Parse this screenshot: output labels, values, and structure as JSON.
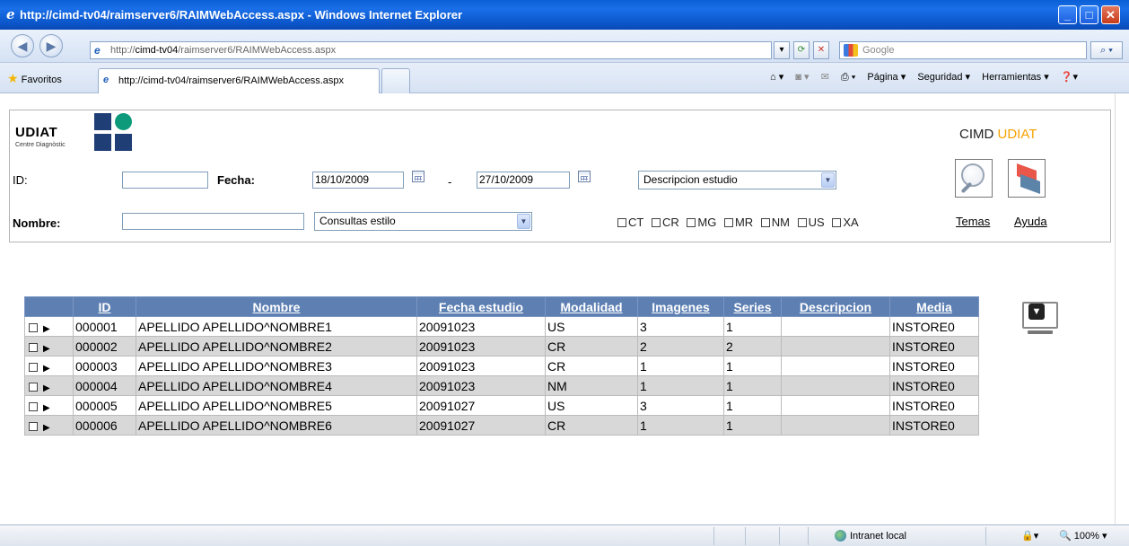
{
  "window": {
    "title": "http://cimd-tv04/raimserver6/RAIMWebAccess.aspx - Windows Internet Explorer",
    "min_label": "_",
    "max_label": "□",
    "close_label": "✕"
  },
  "addressbar": {
    "url_prefix": "http://",
    "url_host": "cimd-tv04",
    "url_path": "/raimserver6/RAIMWebAccess.aspx",
    "search_placeholder": "Google"
  },
  "favbar": {
    "favorites_label": "Favoritos",
    "tab_title": "http://cimd-tv04/raimserver6/RAIMWebAccess.aspx",
    "cmd_pagina": "Página ▾",
    "cmd_seguridad": "Seguridad ▾",
    "cmd_herramientas": "Herramientas ▾"
  },
  "logo": {
    "name": "UDIAT",
    "subtitle": "Centre Diagnòstic",
    "colors": {
      "navy": "#1f3e76",
      "teal": "#0c9a7b"
    }
  },
  "brand": {
    "prefix": "CIMD ",
    "accent": "UDIAT",
    "accent_color": "#f5a300"
  },
  "form": {
    "id_label": "ID:",
    "id_value": "",
    "fecha_label": "Fecha:",
    "date_from": "18/10/2009",
    "date_sep": "-",
    "date_to": "27/10/2009",
    "descripcion_select": "Descripcion estudio",
    "nombre_label": "Nombre:",
    "nombre_value": "",
    "consultas_select": "Consultas estilo",
    "modalities": [
      "CT",
      "CR",
      "MG",
      "MR",
      "NM",
      "US",
      "XA"
    ],
    "temas_link": "Temas",
    "ayuda_link": "Ayuda"
  },
  "table": {
    "headers": [
      "ID",
      "Nombre",
      "Fecha estudio",
      "Modalidad",
      "Imagenes",
      "Series",
      "Descripcion",
      "Media"
    ],
    "rows": [
      [
        "000001",
        "APELLIDO APELLIDO^NOMBRE1",
        "20091023",
        "US",
        "3",
        "1",
        "",
        "INSTORE0"
      ],
      [
        "000002",
        "APELLIDO APELLIDO^NOMBRE2",
        "20091023",
        "CR",
        "2",
        "2",
        "",
        "INSTORE0"
      ],
      [
        "000003",
        "APELLIDO APELLIDO^NOMBRE3",
        "20091023",
        "CR",
        "1",
        "1",
        "",
        "INSTORE0"
      ],
      [
        "000004",
        "APELLIDO APELLIDO^NOMBRE4",
        "20091023",
        "NM",
        "1",
        "1",
        "",
        "INSTORE0"
      ],
      [
        "000005",
        "APELLIDO APELLIDO^NOMBRE5",
        "20091027",
        "US",
        "3",
        "1",
        "",
        "INSTORE0"
      ],
      [
        "000006",
        "APELLIDO APELLIDO^NOMBRE6",
        "20091027",
        "CR",
        "1",
        "1",
        "",
        "INSTORE0"
      ]
    ],
    "header_color": "#5d7fb2",
    "alt_row_color": "#d8d8d8"
  },
  "statusbar": {
    "zone": "Intranet local",
    "zoom": "100%"
  },
  "icons": {
    "search": "magnifier-icon",
    "clear": "eraser-icon",
    "viewer": "monitor-icon"
  }
}
